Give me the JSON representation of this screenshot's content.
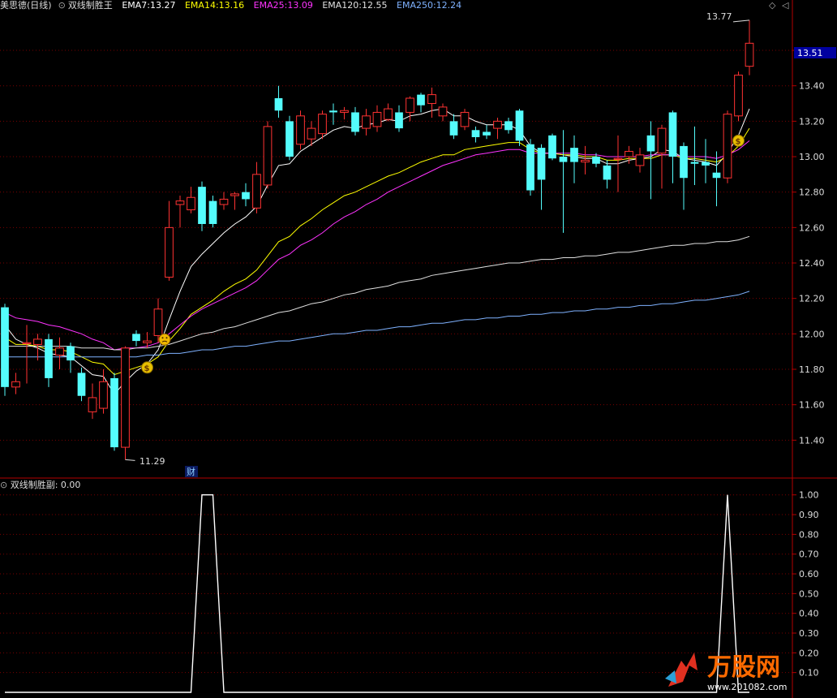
{
  "header": {
    "stock_label": "美思德(日线)",
    "indicator_name": "双线制胜王",
    "ema": [
      {
        "label": "EMA7:",
        "value": "13.27",
        "color": "#ffffff"
      },
      {
        "label": "EMA14:",
        "value": "13.16",
        "color": "#ffff00"
      },
      {
        "label": "EMA25:",
        "value": "13.09",
        "color": "#ff33ff"
      },
      {
        "label": "EMA120:",
        "value": "12.55",
        "color": "#e0e0e0"
      },
      {
        "label": "EMA250:",
        "value": "12.24",
        "color": "#7fb2ff"
      }
    ]
  },
  "sub_header": {
    "indicator_name": "双线制胜副",
    "value_text": ": 0.00"
  },
  "annotations": {
    "high_label": "13.77",
    "low_label": "11.29",
    "current_price": "13.51",
    "cai_label": "财"
  },
  "watermark": {
    "brand": "万股网",
    "url": "www.201082.com"
  },
  "colors": {
    "up": "#ff3232",
    "down": "#54fcfc",
    "grid": "#7a0000",
    "axis": "#b30000",
    "text": "#dddddd",
    "price_box": "#0000a0"
  },
  "chart_data": [
    {
      "type": "candlestick",
      "ylim": [
        11.2,
        13.82
      ],
      "y_ticks": [
        11.4,
        11.6,
        11.8,
        12.0,
        12.2,
        12.4,
        12.6,
        12.8,
        13.0,
        13.2,
        13.4,
        13.6
      ],
      "y_tick_labels": [
        "11.40",
        "11.60",
        "11.80",
        "12.00",
        "12.20",
        "12.40",
        "12.60",
        "12.80",
        "13.00",
        "13.20",
        "13.40",
        "13.60"
      ],
      "candles": [
        [
          12.15,
          11.7,
          12.17,
          11.65
        ],
        [
          11.7,
          11.73,
          11.78,
          11.66
        ],
        [
          11.95,
          11.95,
          12.05,
          11.72
        ],
        [
          11.94,
          11.97,
          12.0,
          11.85
        ],
        [
          11.97,
          11.75,
          12.0,
          11.7
        ],
        [
          11.88,
          11.92,
          11.98,
          11.8
        ],
        [
          11.93,
          11.85,
          11.95,
          11.78
        ],
        [
          11.78,
          11.65,
          11.81,
          11.62
        ],
        [
          11.56,
          11.64,
          11.72,
          11.52
        ],
        [
          11.58,
          11.73,
          11.8,
          11.55
        ],
        [
          11.75,
          11.36,
          11.78,
          11.34
        ],
        [
          11.36,
          11.92,
          11.93,
          11.29
        ],
        [
          12.0,
          11.96,
          12.02,
          11.93
        ],
        [
          11.95,
          11.96,
          12.01,
          11.92
        ],
        [
          11.99,
          12.14,
          12.2,
          11.95
        ],
        [
          12.32,
          12.6,
          12.75,
          12.3
        ],
        [
          12.73,
          12.75,
          12.78,
          12.6
        ],
        [
          12.7,
          12.77,
          12.83,
          12.68
        ],
        [
          12.83,
          12.62,
          12.86,
          12.58
        ],
        [
          12.75,
          12.62,
          12.78,
          12.6
        ],
        [
          12.73,
          12.76,
          12.8,
          12.7
        ],
        [
          12.78,
          12.79,
          12.8,
          12.7
        ],
        [
          12.8,
          12.76,
          12.85,
          12.72
        ],
        [
          12.71,
          12.9,
          12.97,
          12.68
        ],
        [
          12.84,
          13.17,
          13.2,
          12.82
        ],
        [
          13.33,
          13.26,
          13.4,
          13.22
        ],
        [
          13.2,
          13.0,
          13.23,
          12.98
        ],
        [
          13.07,
          13.23,
          13.26,
          13.04
        ],
        [
          13.1,
          13.16,
          13.2,
          13.06
        ],
        [
          13.13,
          13.24,
          13.26,
          13.1
        ],
        [
          13.26,
          13.25,
          13.3,
          13.18
        ],
        [
          13.25,
          13.26,
          13.28,
          13.21
        ],
        [
          13.25,
          13.14,
          13.28,
          13.12
        ],
        [
          13.16,
          13.23,
          13.27,
          13.12
        ],
        [
          13.17,
          13.25,
          13.29,
          13.14
        ],
        [
          13.21,
          13.27,
          13.3,
          13.2
        ],
        [
          13.25,
          13.16,
          13.29,
          13.14
        ],
        [
          13.25,
          13.33,
          13.34,
          13.2
        ],
        [
          13.35,
          13.29,
          13.36,
          13.25
        ],
        [
          13.3,
          13.35,
          13.39,
          13.22
        ],
        [
          13.23,
          13.28,
          13.3,
          13.2
        ],
        [
          13.2,
          13.12,
          13.24,
          13.1
        ],
        [
          13.17,
          13.25,
          13.27,
          13.15
        ],
        [
          13.15,
          13.11,
          13.17,
          13.08
        ],
        [
          13.14,
          13.12,
          13.18,
          13.1
        ],
        [
          13.16,
          13.2,
          13.22,
          13.1
        ],
        [
          13.2,
          13.15,
          13.22,
          13.13
        ],
        [
          13.26,
          13.09,
          13.27,
          13.06
        ],
        [
          13.07,
          12.81,
          13.1,
          12.78
        ],
        [
          13.05,
          12.87,
          13.07,
          12.7
        ],
        [
          13.12,
          12.99,
          13.13,
          12.98
        ],
        [
          13.0,
          12.97,
          13.15,
          12.57
        ],
        [
          13.05,
          12.97,
          13.12,
          12.85
        ],
        [
          12.97,
          12.98,
          13.06,
          12.9
        ],
        [
          13.0,
          12.96,
          13.02,
          12.94
        ],
        [
          12.95,
          12.87,
          12.98,
          12.82
        ],
        [
          12.99,
          12.99,
          13.12,
          12.8
        ],
        [
          13.0,
          13.03,
          13.06,
          12.96
        ],
        [
          12.95,
          13.01,
          13.05,
          12.91
        ],
        [
          13.12,
          13.03,
          13.2,
          12.76
        ],
        [
          13.02,
          13.16,
          13.18,
          12.82
        ],
        [
          13.25,
          13.0,
          13.26,
          12.85
        ],
        [
          13.06,
          12.88,
          13.08,
          12.7
        ],
        [
          12.97,
          12.96,
          13.17,
          12.84
        ],
        [
          12.97,
          12.95,
          13.1,
          12.85
        ],
        [
          12.91,
          12.88,
          13.03,
          12.72
        ],
        [
          12.88,
          13.24,
          13.26,
          12.85
        ],
        [
          13.23,
          13.46,
          13.48,
          13.2
        ],
        [
          13.51,
          13.64,
          13.77,
          13.46
        ]
      ],
      "series": [
        {
          "name": "EMA7",
          "color": "#ffffff",
          "values": [
            12.05,
            11.97,
            11.94,
            11.92,
            11.89,
            11.88,
            11.87,
            11.82,
            11.77,
            11.76,
            11.66,
            11.73,
            11.79,
            11.83,
            11.91,
            12.08,
            12.24,
            12.38,
            12.45,
            12.51,
            12.57,
            12.62,
            12.66,
            12.72,
            12.84,
            12.95,
            12.96,
            13.03,
            13.07,
            13.11,
            13.15,
            13.17,
            13.16,
            13.18,
            13.19,
            13.21,
            13.2,
            13.23,
            13.24,
            13.26,
            13.27,
            13.23,
            13.23,
            13.2,
            13.18,
            13.18,
            13.18,
            13.15,
            13.06,
            13.02,
            13.02,
            13.01,
            13.0,
            12.99,
            12.99,
            12.96,
            12.96,
            12.98,
            12.99,
            13.0,
            13.04,
            13.03,
            12.99,
            12.98,
            12.97,
            12.95,
            13.02,
            13.12,
            13.27
          ]
        },
        {
          "name": "EMA14",
          "color": "#ffff00",
          "values": [
            11.98,
            11.94,
            11.94,
            11.93,
            11.91,
            11.91,
            11.9,
            11.87,
            11.84,
            11.83,
            11.77,
            11.79,
            11.81,
            11.83,
            11.87,
            11.96,
            12.03,
            12.11,
            12.15,
            12.19,
            12.24,
            12.28,
            12.31,
            12.36,
            12.44,
            12.52,
            12.55,
            12.61,
            12.65,
            12.7,
            12.74,
            12.78,
            12.8,
            12.83,
            12.86,
            12.89,
            12.91,
            12.94,
            12.97,
            12.99,
            13.01,
            13.01,
            13.04,
            13.05,
            13.06,
            13.07,
            13.08,
            13.08,
            13.04,
            13.02,
            13.02,
            13.01,
            13.01,
            13.0,
            13.0,
            12.98,
            12.98,
            12.99,
            12.99,
            12.99,
            13.01,
            13.01,
            12.99,
            12.99,
            12.98,
            12.97,
            13.0,
            13.06,
            13.16
          ]
        },
        {
          "name": "EMA25",
          "color": "#ff33ff",
          "values": [
            12.12,
            12.09,
            12.08,
            12.07,
            12.05,
            12.04,
            12.02,
            12.0,
            11.97,
            11.95,
            11.91,
            11.92,
            11.92,
            11.93,
            11.95,
            12.0,
            12.05,
            12.1,
            12.14,
            12.17,
            12.2,
            12.23,
            12.26,
            12.3,
            12.36,
            12.42,
            12.45,
            12.5,
            12.53,
            12.57,
            12.62,
            12.66,
            12.69,
            12.73,
            12.76,
            12.8,
            12.83,
            12.86,
            12.89,
            12.92,
            12.95,
            12.97,
            12.99,
            13.01,
            13.02,
            13.03,
            13.04,
            13.04,
            13.02,
            13.02,
            13.02,
            13.02,
            13.02,
            13.01,
            13.01,
            13.0,
            13.0,
            13.0,
            13.0,
            13.01,
            13.01,
            13.01,
            13.0,
            13.0,
            13.0,
            12.99,
            13.01,
            13.04,
            13.09
          ]
        },
        {
          "name": "EMA120",
          "color": "#e0e0e0",
          "values": [
            11.93,
            11.93,
            11.93,
            11.93,
            11.93,
            11.93,
            11.93,
            11.92,
            11.92,
            11.92,
            11.91,
            11.91,
            11.92,
            11.92,
            11.93,
            11.94,
            11.96,
            11.98,
            12.0,
            12.01,
            12.03,
            12.04,
            12.06,
            12.08,
            12.1,
            12.12,
            12.13,
            12.15,
            12.17,
            12.18,
            12.2,
            12.22,
            12.23,
            12.25,
            12.26,
            12.27,
            12.29,
            12.3,
            12.31,
            12.33,
            12.34,
            12.35,
            12.36,
            12.37,
            12.38,
            12.39,
            12.4,
            12.4,
            12.41,
            12.42,
            12.42,
            12.43,
            12.43,
            12.44,
            12.44,
            12.45,
            12.46,
            12.46,
            12.47,
            12.48,
            12.49,
            12.5,
            12.5,
            12.51,
            12.51,
            12.52,
            12.52,
            12.53,
            12.55
          ]
        },
        {
          "name": "EMA250",
          "color": "#7fb2ff",
          "values": [
            11.87,
            11.87,
            11.87,
            11.87,
            11.87,
            11.87,
            11.87,
            11.87,
            11.87,
            11.87,
            11.87,
            11.87,
            11.87,
            11.88,
            11.88,
            11.89,
            11.89,
            11.9,
            11.91,
            11.91,
            11.92,
            11.93,
            11.93,
            11.94,
            11.95,
            11.96,
            11.96,
            11.97,
            11.98,
            11.99,
            12.0,
            12.0,
            12.01,
            12.02,
            12.02,
            12.03,
            12.04,
            12.04,
            12.05,
            12.06,
            12.06,
            12.07,
            12.08,
            12.08,
            12.09,
            12.09,
            12.1,
            12.1,
            12.11,
            12.11,
            12.12,
            12.12,
            12.13,
            12.13,
            12.14,
            12.14,
            12.15,
            12.15,
            12.16,
            12.16,
            12.17,
            12.17,
            12.18,
            12.19,
            12.19,
            12.2,
            12.21,
            12.22,
            12.24
          ]
        }
      ],
      "signals": [
        {
          "index": 13,
          "symbol": "$"
        },
        {
          "index": 67,
          "symbol": "$"
        }
      ],
      "smiley_index": 14,
      "grid": true
    },
    {
      "type": "line",
      "ylim": [
        0,
        1.04
      ],
      "y_ticks": [
        0.1,
        0.2,
        0.3,
        0.4,
        0.5,
        0.6,
        0.7,
        0.8,
        0.9,
        1.0
      ],
      "y_tick_labels": [
        "0.10",
        "0.20",
        "0.30",
        "0.40",
        "0.50",
        "0.60",
        "0.70",
        "0.80",
        "0.90",
        "1.00"
      ],
      "values": [
        0,
        0,
        0,
        0,
        0,
        0,
        0,
        0,
        0,
        0,
        0,
        0,
        0,
        0,
        0,
        0,
        0,
        0,
        1,
        1,
        0,
        0,
        0,
        0,
        0,
        0,
        0,
        0,
        0,
        0,
        0,
        0,
        0,
        0,
        0,
        0,
        0,
        0,
        0,
        0,
        0,
        0,
        0,
        0,
        0,
        0,
        0,
        0,
        0,
        0,
        0,
        0,
        0,
        0,
        0,
        0,
        0,
        0,
        0,
        0,
        0,
        0,
        0,
        0,
        0,
        0,
        1,
        0,
        0
      ],
      "grid": true
    }
  ]
}
